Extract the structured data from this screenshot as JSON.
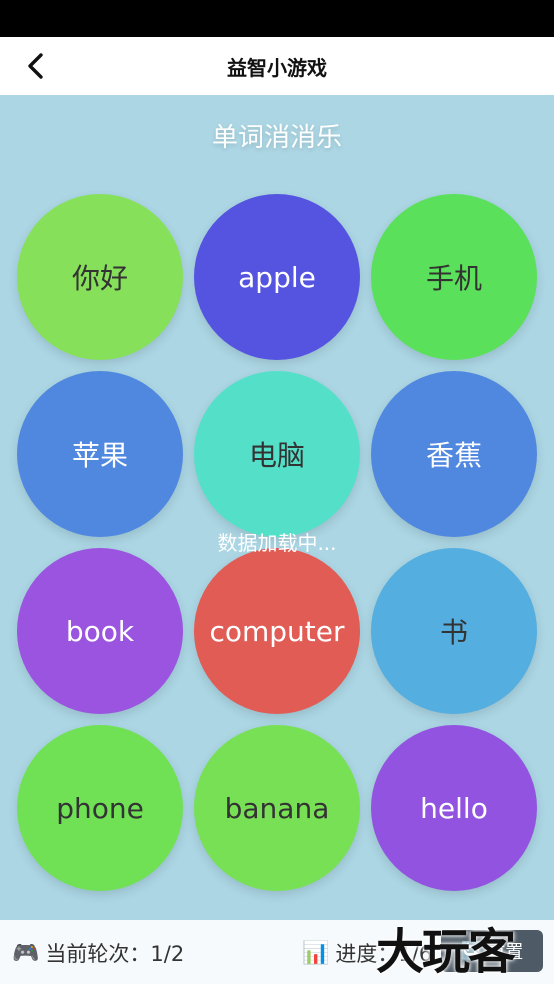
{
  "header": {
    "title": "益智小游戏",
    "back_icon": "chevron-left-icon"
  },
  "game": {
    "title": "单词消消乐",
    "loading_text": "数据加载中...",
    "bubbles": [
      {
        "label": "你好",
        "color": "#86e05a",
        "text_color": "#333333"
      },
      {
        "label": "apple",
        "color": "#5454e0",
        "text_color": "#ffffff"
      },
      {
        "label": "手机",
        "color": "#5ae05a",
        "text_color": "#333333"
      },
      {
        "label": "苹果",
        "color": "#5088e0",
        "text_color": "#ffffff"
      },
      {
        "label": "电脑",
        "color": "#54e0c8",
        "text_color": "#333333"
      },
      {
        "label": "香蕉",
        "color": "#5088e0",
        "text_color": "#ffffff"
      },
      {
        "label": "book",
        "color": "#9a54e0",
        "text_color": "#ffffff"
      },
      {
        "label": "computer",
        "color": "#e05c54",
        "text_color": "#ffffff"
      },
      {
        "label": "书",
        "color": "#54aee0",
        "text_color": "#333333"
      },
      {
        "label": "phone",
        "color": "#70e054",
        "text_color": "#333333"
      },
      {
        "label": "banana",
        "color": "#78e054",
        "text_color": "#333333"
      },
      {
        "label": "hello",
        "color": "#9254e0",
        "text_color": "#ffffff"
      }
    ]
  },
  "footer": {
    "round_icon": "🎮",
    "round_text": "当前轮次：1/2",
    "progress_icon": "📊",
    "progress_text": "进度：1/6",
    "reset_icon": "🔄",
    "reset_label": "重置"
  },
  "watermark": "大玩客"
}
